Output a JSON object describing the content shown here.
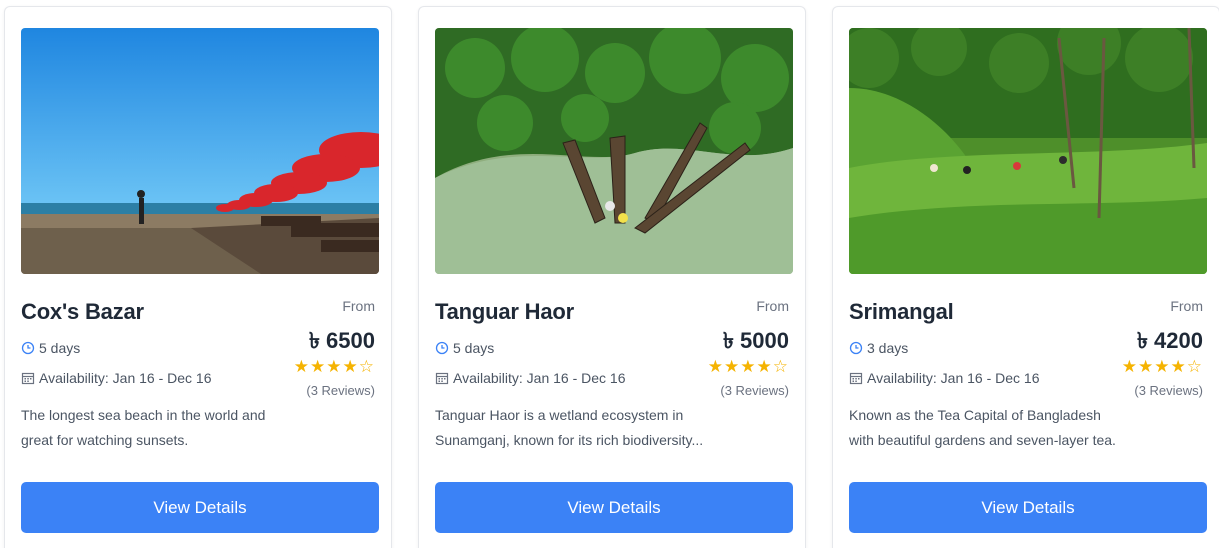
{
  "cards": [
    {
      "title": "Cox's Bazar",
      "from_label": "From",
      "price": "৳ 6500",
      "days": "5 days",
      "availability": "Availability: Jan 16 - Dec 16",
      "rating": 4,
      "rating_max": 5,
      "reviews": "(3 Reviews)",
      "description": "The longest sea beach in the world and great for watching sunsets.",
      "button_label": "View Details"
    },
    {
      "title": "Tanguar Haor",
      "from_label": "From",
      "price": "৳ 5000",
      "days": "5 days",
      "availability": "Availability: Jan 16 - Dec 16",
      "rating": 4,
      "rating_max": 5,
      "reviews": "(3 Reviews)",
      "description": "Tanguar Haor is a wetland ecosystem in Sunamganj, known for its rich biodiversity...",
      "button_label": "View Details"
    },
    {
      "title": "Srimangal",
      "from_label": "From",
      "price": "৳ 4200",
      "days": "3 days",
      "availability": "Availability: Jan 16 - Dec 16",
      "rating": 4,
      "rating_max": 5,
      "reviews": "(3 Reviews)",
      "description": "Known as the Tea Capital of Bangladesh with beautiful gardens and seven-layer tea.",
      "button_label": "View Details"
    }
  ],
  "colors": {
    "accent": "#3b82f6",
    "star": "#f5b301",
    "title": "#1f2937",
    "muted": "#6b7280"
  },
  "icons": {
    "days": "clock-icon",
    "availability": "calendar-icon",
    "rating": "star-icon"
  }
}
